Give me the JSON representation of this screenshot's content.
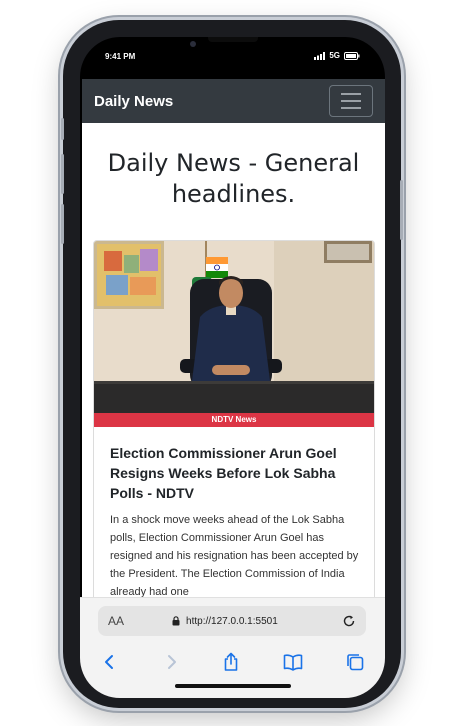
{
  "status_bar": {
    "time": "9:41 PM",
    "network": "5G"
  },
  "navbar": {
    "brand": "Daily News"
  },
  "page": {
    "heading": "Daily News - General headlines."
  },
  "article": {
    "source": "NDTV News",
    "title": "Election Commissioner Arun Goel Resigns Weeks Before Lok Sabha Polls - NDTV",
    "description": "In a shock move weeks ahead of the Lok Sabha polls, Election Commissioner Arun Goel has resigned and his resignation has been accepted by the President. The Election Commission of India already had one"
  },
  "browser": {
    "text_size_label": "AA",
    "url": "http://127.0.0.1:5501"
  },
  "icons": [
    "signal-icon",
    "battery-icon",
    "menu-icon",
    "lock-icon",
    "reload-icon",
    "back-icon",
    "forward-icon",
    "share-icon",
    "bookmarks-icon",
    "tabs-icon"
  ],
  "colors": {
    "navbar": "#343a40",
    "badge": "#dc3545",
    "toolbar_icon": "#1a73e8"
  }
}
